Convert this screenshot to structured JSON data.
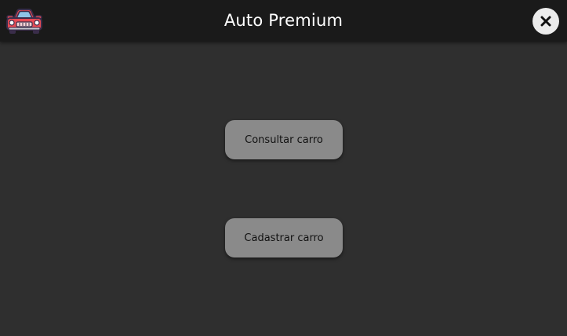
{
  "header": {
    "logo_icon": "red-car-icon",
    "title": "Auto Premium",
    "close_icon": "close-icon"
  },
  "main": {
    "consult_button_label": "Consultar carro",
    "register_button_label": "Cadastrar carro"
  },
  "colors": {
    "background": "#2f2f2f",
    "titlebar": "#1a1a1a",
    "button": "#8a8a8a",
    "car_body": "#e84b55",
    "car_outline": "#3a2d4a",
    "close_button": "#ececec"
  }
}
